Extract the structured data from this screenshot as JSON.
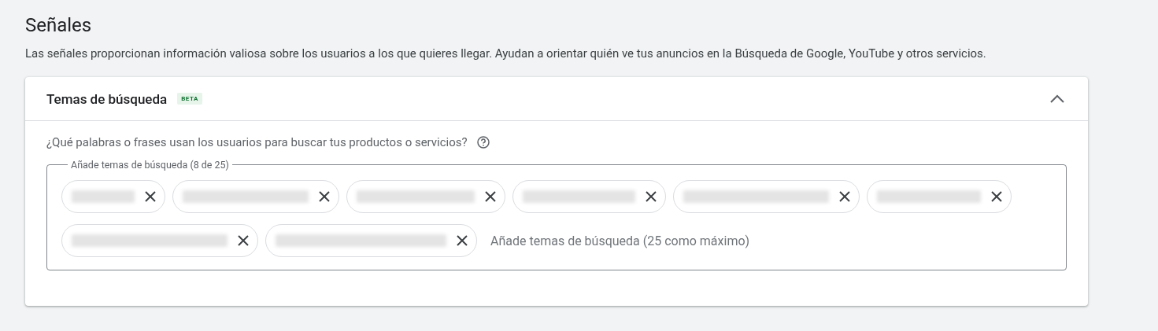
{
  "section": {
    "title": "Señales",
    "description": "Las señales proporcionan información valiosa sobre los usuarios a los que quieres llegar. Ayudan a orientar quién ve tus anuncios en la Búsqueda de Google, YouTube y otros servicios."
  },
  "card": {
    "title": "Temas de búsqueda",
    "badge": "BETA",
    "expanded": true,
    "question": "¿Qué palabras o frases usan los usuarios para buscar tus productos o servicios?",
    "field": {
      "label": "Añade temas de búsqueda (8 de 25)",
      "placeholder": "Añade temas de búsqueda (25 como máximo)",
      "chips": [
        {
          "kind": "redacted"
        },
        {
          "kind": "redacted"
        },
        {
          "kind": "redacted"
        },
        {
          "kind": "redacted"
        },
        {
          "kind": "redacted"
        },
        {
          "kind": "redacted"
        },
        {
          "kind": "redacted"
        },
        {
          "kind": "redacted"
        }
      ]
    }
  }
}
